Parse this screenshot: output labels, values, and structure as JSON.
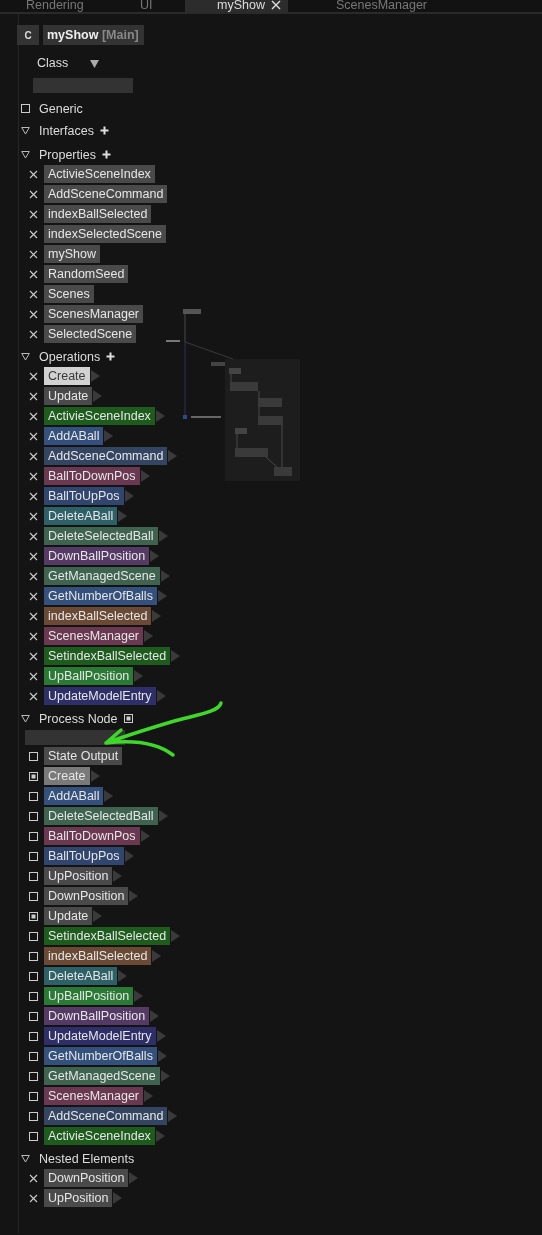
{
  "tabs": [
    {
      "label": "Rendering",
      "selected": false
    },
    {
      "label": "UI",
      "selected": false
    },
    {
      "label": "myShow",
      "selected": true,
      "closable": true
    },
    {
      "label": "ScenesManager",
      "selected": false
    }
  ],
  "header": {
    "badge": "C",
    "title": "myShow",
    "tag": "[Main]"
  },
  "class_dropdown": {
    "value": "Class"
  },
  "generic": {
    "label": "Generic",
    "checked": false
  },
  "sections": [
    {
      "title": "Interfaces",
      "expanded": true,
      "kind": "plus"
    },
    {
      "title": "Properties",
      "expanded": true,
      "kind": "plus",
      "items": [
        {
          "label": "ActivieSceneIndex",
          "kind": "remove",
          "color": "#4a4a4a"
        },
        {
          "label": "AddSceneCommand",
          "kind": "remove",
          "color": "#4a4a4a"
        },
        {
          "label": "indexBallSelected",
          "kind": "remove",
          "color": "#4a4a4a"
        },
        {
          "label": "indexSelectedScene",
          "kind": "remove",
          "color": "#4a4a4a"
        },
        {
          "label": "myShow",
          "kind": "remove",
          "color": "#4a4a4a"
        },
        {
          "label": "RandomSeed",
          "kind": "remove",
          "color": "#4a4a4a"
        },
        {
          "label": "Scenes",
          "kind": "remove",
          "color": "#4a4a4a"
        },
        {
          "label": "ScenesManager",
          "kind": "remove",
          "color": "#4a4a4a"
        },
        {
          "label": "SelectedScene",
          "kind": "remove",
          "color": "#4a4a4a"
        }
      ]
    },
    {
      "title": "Operations",
      "expanded": true,
      "kind": "plus",
      "items": [
        {
          "label": "Create",
          "kind": "remove",
          "color": "#d2d2d2",
          "arrow": true
        },
        {
          "label": "Update",
          "kind": "remove",
          "color": "#4a4a4a",
          "arrow": true
        },
        {
          "label": "ActivieSceneIndex",
          "kind": "remove",
          "color": "#1d5c1d",
          "arrow": true
        },
        {
          "label": "AddABall",
          "kind": "remove",
          "color": "#34507c",
          "arrow": true
        },
        {
          "label": "AddSceneCommand",
          "kind": "remove",
          "color": "#344562",
          "arrow": true
        },
        {
          "label": "BallToDownPos",
          "kind": "remove",
          "color": "#6a3850",
          "arrow": true
        },
        {
          "label": "BallToUpPos",
          "kind": "remove",
          "color": "#30466e",
          "arrow": true
        },
        {
          "label": "DeleteABall",
          "kind": "remove",
          "color": "#2e6068",
          "arrow": true
        },
        {
          "label": "DeleteSelectedBall",
          "kind": "remove",
          "color": "#3e6450",
          "arrow": true
        },
        {
          "label": "DownBallPosition",
          "kind": "remove",
          "color": "#563a66",
          "arrow": true
        },
        {
          "label": "GetManagedScene",
          "kind": "remove",
          "color": "#3e6450",
          "arrow": true
        },
        {
          "label": "GetNumberOfBalls",
          "kind": "remove",
          "color": "#34507c",
          "arrow": true
        },
        {
          "label": "indexBallSelected",
          "kind": "remove",
          "color": "#6a4a34",
          "arrow": true
        },
        {
          "label": "ScenesManager",
          "kind": "remove",
          "color": "#6a3850",
          "arrow": true
        },
        {
          "label": "SetindexBallSelected",
          "kind": "remove",
          "color": "#1d5c1d",
          "arrow": true
        },
        {
          "label": "UpBallPosition",
          "kind": "remove",
          "color": "#2a7a36",
          "arrow": true
        },
        {
          "label": "UpdateModelEntry",
          "kind": "remove",
          "color": "#2e2e68",
          "arrow": true
        }
      ]
    },
    {
      "title": "Process Node",
      "expanded": true,
      "kind": "box",
      "field": true,
      "items": [
        {
          "label": "State Output",
          "kind": "check",
          "checked": false,
          "color": "#4a4a4a",
          "arrow": false
        },
        {
          "label": "Create",
          "kind": "check",
          "checked": true,
          "color": "#7a7a7a",
          "arrow": true
        },
        {
          "label": "AddABall",
          "kind": "check",
          "checked": false,
          "color": "#34507c",
          "arrow": true
        },
        {
          "label": "DeleteSelectedBall",
          "kind": "check",
          "checked": false,
          "color": "#3e6450",
          "arrow": true
        },
        {
          "label": "BallToDownPos",
          "kind": "check",
          "checked": false,
          "color": "#6a3850",
          "arrow": true
        },
        {
          "label": "BallToUpPos",
          "kind": "check",
          "checked": false,
          "color": "#30466e",
          "arrow": true
        },
        {
          "label": "UpPosition",
          "kind": "check",
          "checked": false,
          "color": "#4a4a4a",
          "arrow": true
        },
        {
          "label": "DownPosition",
          "kind": "check",
          "checked": false,
          "color": "#4a4a4a",
          "arrow": true
        },
        {
          "label": "Update",
          "kind": "check",
          "checked": true,
          "color": "#4a4a4a",
          "arrow": true
        },
        {
          "label": "SetindexBallSelected",
          "kind": "check",
          "checked": false,
          "color": "#1d5c1d",
          "arrow": true
        },
        {
          "label": "indexBallSelected",
          "kind": "check",
          "checked": false,
          "color": "#6a4a34",
          "arrow": true
        },
        {
          "label": "DeleteABall",
          "kind": "check",
          "checked": false,
          "color": "#2e6068",
          "arrow": true
        },
        {
          "label": "UpBallPosition",
          "kind": "check",
          "checked": false,
          "color": "#2a7a36",
          "arrow": true
        },
        {
          "label": "DownBallPosition",
          "kind": "check",
          "checked": false,
          "color": "#563a66",
          "arrow": true
        },
        {
          "label": "UpdateModelEntry",
          "kind": "check",
          "checked": false,
          "color": "#2e2e68",
          "arrow": true
        },
        {
          "label": "GetNumberOfBalls",
          "kind": "check",
          "checked": false,
          "color": "#34507c",
          "arrow": true
        },
        {
          "label": "GetManagedScene",
          "kind": "check",
          "checked": false,
          "color": "#3e6450",
          "arrow": true
        },
        {
          "label": "ScenesManager",
          "kind": "check",
          "checked": false,
          "color": "#6a3850",
          "arrow": true
        },
        {
          "label": "AddSceneCommand",
          "kind": "check",
          "checked": false,
          "color": "#344562",
          "arrow": true
        },
        {
          "label": "ActivieSceneIndex",
          "kind": "check",
          "checked": false,
          "color": "#1d5c1d",
          "arrow": true
        }
      ]
    },
    {
      "title": "Nested Elements",
      "expanded": true,
      "items": [
        {
          "label": "DownPosition",
          "kind": "remove",
          "color": "#4a4a4a",
          "arrow": true
        },
        {
          "label": "UpPosition",
          "kind": "remove",
          "color": "#4a4a4a",
          "arrow": true
        }
      ]
    }
  ]
}
